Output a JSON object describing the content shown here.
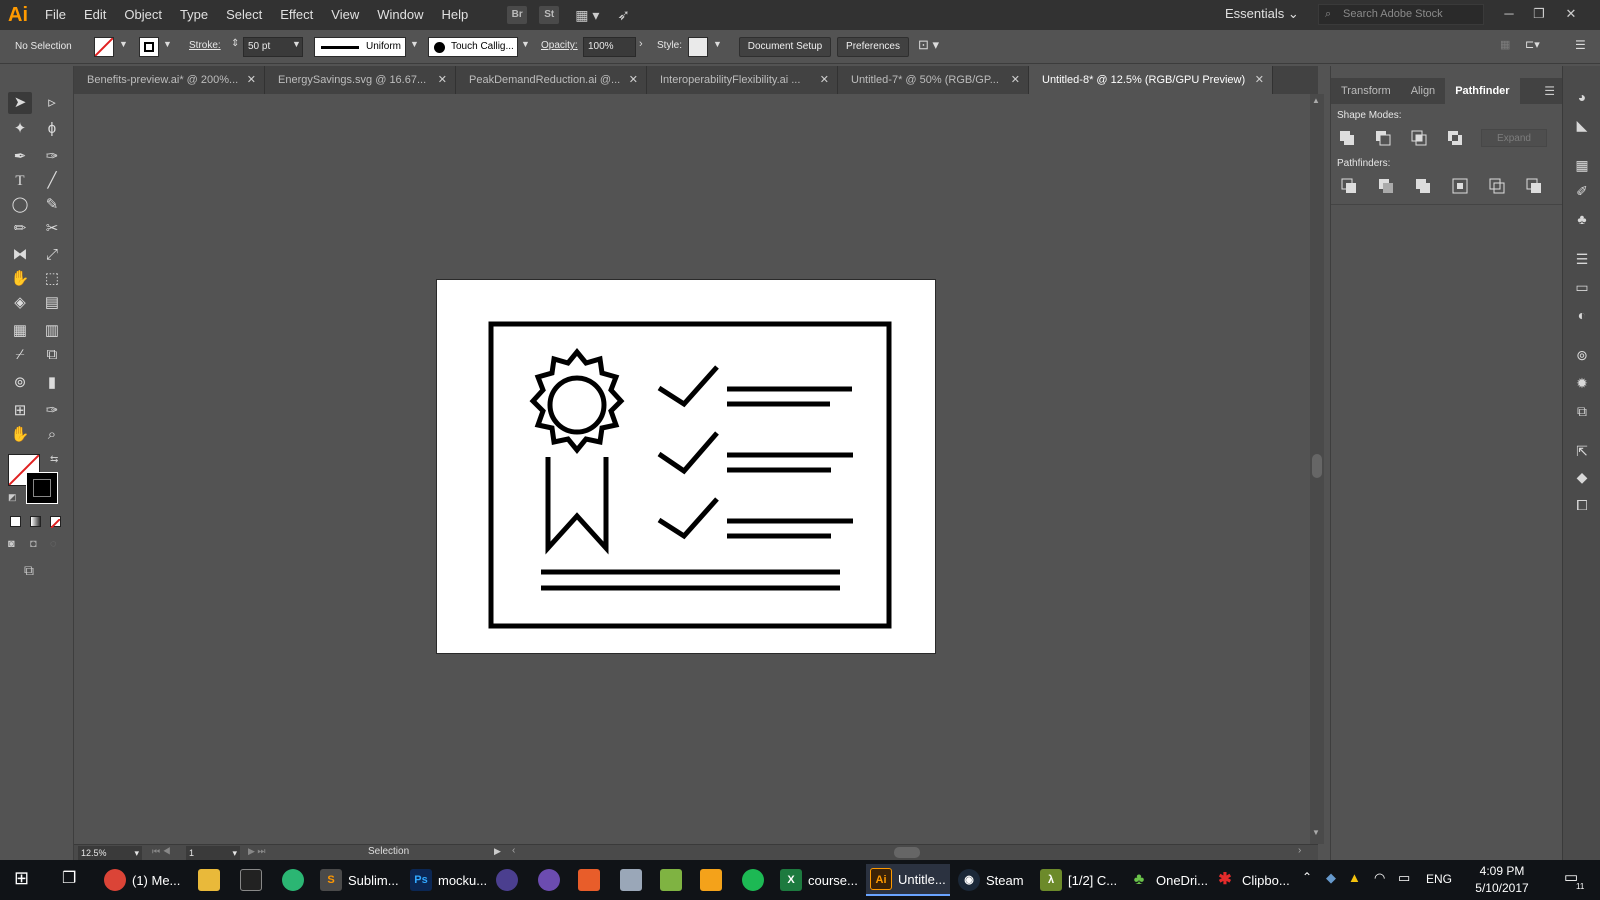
{
  "app": {
    "logo": "Ai"
  },
  "menu": [
    "File",
    "Edit",
    "Object",
    "Type",
    "Select",
    "Effect",
    "View",
    "Window",
    "Help"
  ],
  "menubar_chips": [
    "Br",
    "St"
  ],
  "workspace": "Essentials",
  "stock_search_placeholder": "Search Adobe Stock",
  "control": {
    "selection": "No Selection",
    "stroke_label": "Stroke:",
    "stroke_value": "50 pt",
    "profile": "Uniform",
    "brush": "Touch Callig...",
    "opacity_label": "Opacity:",
    "opacity_value": "100%",
    "style_label": "Style:",
    "doc_setup": "Document Setup",
    "preferences": "Preferences"
  },
  "tabs": [
    {
      "label": "Benefits-preview.ai* @ 200%..."
    },
    {
      "label": "EnergySavings.svg @ 16.67..."
    },
    {
      "label": "PeakDemandReduction.ai @..."
    },
    {
      "label": "InteroperabilityFlexibility.ai ..."
    },
    {
      "label": "Untitled-7* @ 50% (RGB/GP..."
    },
    {
      "label": "Untitled-8* @ 12.5% (RGB/GPU Preview)",
      "active": true
    }
  ],
  "panel": {
    "tabs": [
      "Transform",
      "Align",
      "Pathfinder"
    ],
    "active_tab": "Pathfinder",
    "shape_modes": "Shape Modes:",
    "pathfinders": "Pathfinders:",
    "expand": "Expand"
  },
  "status": {
    "zoom": "12.5%",
    "artboard": "1",
    "tool": "Selection"
  },
  "taskbar": {
    "apps": [
      {
        "label": "(1) Me...",
        "color": "#db4437",
        "glyph": "G"
      },
      {
        "label": "Sublim...",
        "color": "#4a4a4a",
        "glyph": "S"
      },
      {
        "label": "mocku...",
        "color": "#1d3c8c",
        "glyph": "Ps"
      },
      {
        "label": "course...",
        "color": "#1d7a3f",
        "glyph": "X"
      },
      {
        "label": "Untitle...",
        "color": "#3a2207",
        "glyph": "Ai",
        "active": true
      },
      {
        "label": "Steam",
        "color": "#1b2838",
        "glyph": "◉"
      },
      {
        "label": "[1/2] C...",
        "color": "#6c8a2a",
        "glyph": "λ"
      },
      {
        "label": "OneDri...",
        "color": "#2f7d32",
        "glyph": "♣"
      },
      {
        "label": "Clipbo...",
        "color": "#c0262b",
        "glyph": "✱"
      }
    ],
    "lang": "ENG",
    "time": "4:09 PM",
    "date": "5/10/2017",
    "notifications": "11"
  }
}
